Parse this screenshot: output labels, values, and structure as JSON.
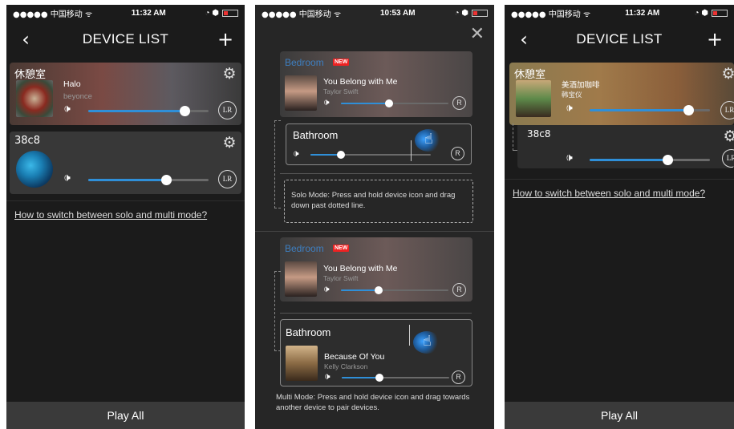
{
  "status_left": {
    "carrier": "●●●●● 中国移动 ᯤ",
    "time": "11:32 AM"
  },
  "status_mid": {
    "carrier": "●●●●● 中国移动 ᯤ",
    "time": "10:53 AM"
  },
  "status_right": {
    "carrier": "●●●●● 中国移动 ᯤ",
    "time": "11:32 AM"
  },
  "status_icons": "◔ ⬢",
  "nav": {
    "title": "DEVICE LIST",
    "back": "‹",
    "add": "+"
  },
  "screen1": {
    "devices": [
      {
        "room": "休憩室",
        "track": "Halo",
        "artist": "beyonce",
        "volume": 0.8
      },
      {
        "room": "38c8",
        "track": "",
        "artist": "",
        "volume": 0.65
      }
    ],
    "help_link": "How to switch between solo and multi mode?",
    "play_all": "Play All"
  },
  "screen2": {
    "close": "✕",
    "solo": {
      "top_room": "Bedroom",
      "new_tag": "NEW",
      "top_track": "You Belong with Me",
      "top_artist": "Taylor Swift",
      "top_volume": 0.45,
      "bottom_room": "Bathroom",
      "bottom_volume": 0.25,
      "note": "Solo Mode: Press and hold device icon and drag down past dotted line."
    },
    "multi": {
      "top_room": "Bedroom",
      "new_tag": "NEW",
      "top_track": "You Belong with Me",
      "top_artist": "Taylor Swift",
      "top_volume": 0.35,
      "bottom_room": "Bathroom",
      "bottom_track": "Because Of You",
      "bottom_artist": "Kelly Clarkson",
      "bottom_volume": 0.35,
      "note": "Multi Mode: Press and hold device icon and drag towards another device to pair devices."
    },
    "r_label": "R"
  },
  "screen3": {
    "group_room": "休憩室",
    "track": "美酒加咖啡",
    "artist": "韩宝仪",
    "volume": 0.82,
    "sub_room": "38c8",
    "sub_volume": 0.65,
    "help_link": "How to switch between solo and multi mode?",
    "play_all": "Play All"
  },
  "lr_label": "LR",
  "colors": {
    "accent": "#2f8fd8",
    "background": "#1b1b1b",
    "new_tag": "#e22222"
  },
  "icons": [
    "back-arrow-icon",
    "add-icon",
    "gear-icon",
    "speaker-icon",
    "lr-icon",
    "close-icon",
    "hand-tap-icon"
  ]
}
